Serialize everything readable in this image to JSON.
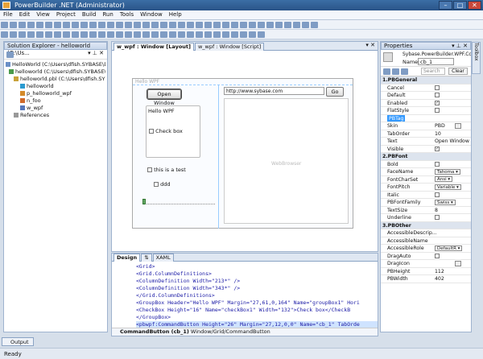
{
  "window": {
    "title": "PowerBuilder .NET (Administrator)",
    "min": "–",
    "max": "□",
    "close": "✕"
  },
  "menu": [
    "File",
    "Edit",
    "View",
    "Project",
    "Build",
    "Run",
    "Tools",
    "Window",
    "Help"
  ],
  "solution_explorer": {
    "title": "Solution Explorer - helloworld (C:\\Us...",
    "items": [
      "HelloWorld (C:\\Users\\dfish.SYBASE\\Docum",
      "helloworld (C:\\Users\\dfish.SYBASE\\Doc",
      "helloworld.pbl (C:\\Users\\dfish.SYBASE\\",
      "helloworld",
      "p_helloworld_wpf",
      "n_foo",
      "w_wpf",
      "References"
    ]
  },
  "editor": {
    "tabs": [
      "w_wpf : Window [Layout]",
      "w_wpf : Window [Script]"
    ],
    "form": {
      "title": "Hello WPF",
      "open_button": "Open Window",
      "url": "http://www.sybase.com",
      "go_button": "Go",
      "group_header": "Hello WPF",
      "checkbox_label": "Check box",
      "checkbox2_label": "this is a test",
      "checkbox3_label": "ddd",
      "browser_label": "WebBrowser"
    },
    "bottom_tabs": {
      "design": "Design",
      "swap": "⇅",
      "xaml": "XAML"
    },
    "xaml_lines": [
      "<Grid>",
      "    <Grid.ColumnDefinitions>",
      "        <ColumnDefinition Width=\"213*\" />",
      "        <ColumnDefinition Width=\"343*\" />",
      "    </Grid.ColumnDefinitions>",
      "    <GroupBox Header=\"Hello WPF\" Margin=\"27,61,0,164\" Name=\"groupBox1\" Hori",
      "        <CheckBox Height=\"16\" Name=\"checkBox1\" Width=\"132\">Check box</CheckB",
      "    </GroupBox>",
      "    <pbwpf:CommandButton Height=\"26\" Margin=\"27,12,0,0\" Name=\"cb_1\" TabOrde"
    ],
    "status_path_bold": "CommandButton (cb_1)",
    "status_path": "Window/Grid/CommandButton"
  },
  "properties": {
    "title": "Properties",
    "type": "Sybase.PowerBuilder.WPF.Con...",
    "name_label": "Name:",
    "name_value": "cb_1",
    "search_placeholder": "Search",
    "clear": "Clear",
    "side_tab": "Toolbox",
    "rows": [
      {
        "name": "1.PBGeneral",
        "cat": true
      },
      {
        "name": "Cancel",
        "chk": ""
      },
      {
        "name": "Default",
        "chk": ""
      },
      {
        "name": "Enabled",
        "chk": "✓"
      },
      {
        "name": "FlatStyle",
        "chk": ""
      },
      {
        "name": "PBTag",
        "sel": true
      },
      {
        "name": "Skin",
        "val": "PBD",
        "btn": true
      },
      {
        "name": "TabOrder",
        "val": "10"
      },
      {
        "name": "Text",
        "val": "Open Window"
      },
      {
        "name": "Visible",
        "chk": "✓"
      },
      {
        "name": "2.PBFont",
        "cat": true
      },
      {
        "name": "Bold",
        "chk": ""
      },
      {
        "name": "FaceName",
        "dd": "Tahoma"
      },
      {
        "name": "FontCharSet",
        "dd": "Ansi"
      },
      {
        "name": "FontPitch",
        "dd": "Variable"
      },
      {
        "name": "Italic",
        "chk": ""
      },
      {
        "name": "PBFontFamily",
        "dd": "Swiss"
      },
      {
        "name": "TextSize",
        "val": "8"
      },
      {
        "name": "Underline",
        "chk": ""
      },
      {
        "name": "3.PBOther",
        "cat": true
      },
      {
        "name": "AccessibleDescrip..."
      },
      {
        "name": "AccessibleName"
      },
      {
        "name": "AccessibleRole",
        "dd": "DefaultR"
      },
      {
        "name": "DragAuto",
        "chk": ""
      },
      {
        "name": "DragIcon",
        "btn": true
      },
      {
        "name": "PBHeight",
        "val": "112"
      },
      {
        "name": "PBWidth",
        "val": "402"
      }
    ]
  },
  "output_tab": "Output",
  "status": "Ready",
  "colors": {
    "title": "#2a5488",
    "selection": "#3399ff",
    "designer_bg": "#ffffff"
  }
}
